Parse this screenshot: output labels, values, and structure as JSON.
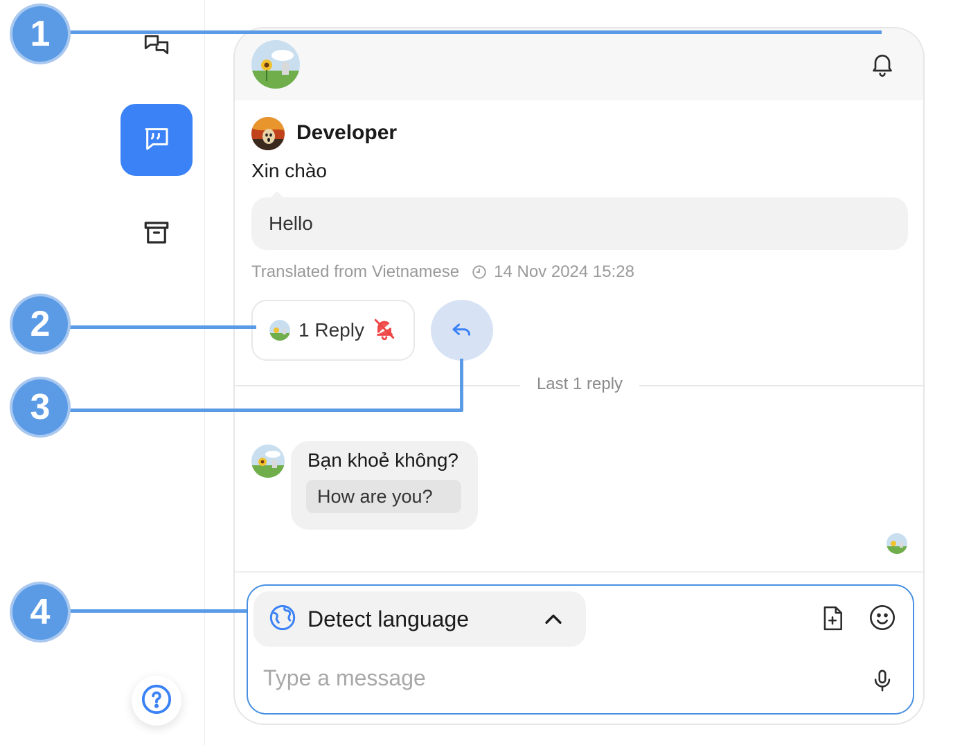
{
  "sidebar": {
    "items": [
      {
        "name": "chats",
        "icon": "chat-bubbles-icon"
      },
      {
        "name": "threads",
        "icon": "quote-bubble-icon",
        "active": true
      },
      {
        "name": "archive",
        "icon": "archive-icon"
      }
    ],
    "help_icon": "question-icon"
  },
  "header": {
    "bell_icon": "bell-icon"
  },
  "message": {
    "author": "Developer",
    "text": "Xin chào",
    "translation": "Hello",
    "translated_note": "Translated from Vietnamese",
    "timestamp": "14 Nov 2024 15:28"
  },
  "thread": {
    "reply_count_label": "1 Reply",
    "muted_icon": "bell-off-icon",
    "reply_icon": "reply-arrow-icon",
    "divider_label": "Last 1 reply"
  },
  "reply": {
    "text": "Bạn khoẻ không?",
    "translation": "How are you?"
  },
  "composer": {
    "language_label": "Detect language",
    "placeholder": "Type a message",
    "attach_icon": "file-add-icon",
    "emoji_icon": "smile-icon",
    "mic_icon": "microphone-icon"
  },
  "callouts": [
    "1",
    "2",
    "3",
    "4"
  ],
  "colors": {
    "accent": "#3b82f6",
    "callout": "#5b9be6",
    "muted_red": "#ef4444",
    "composer_border": "#4a90e2"
  }
}
